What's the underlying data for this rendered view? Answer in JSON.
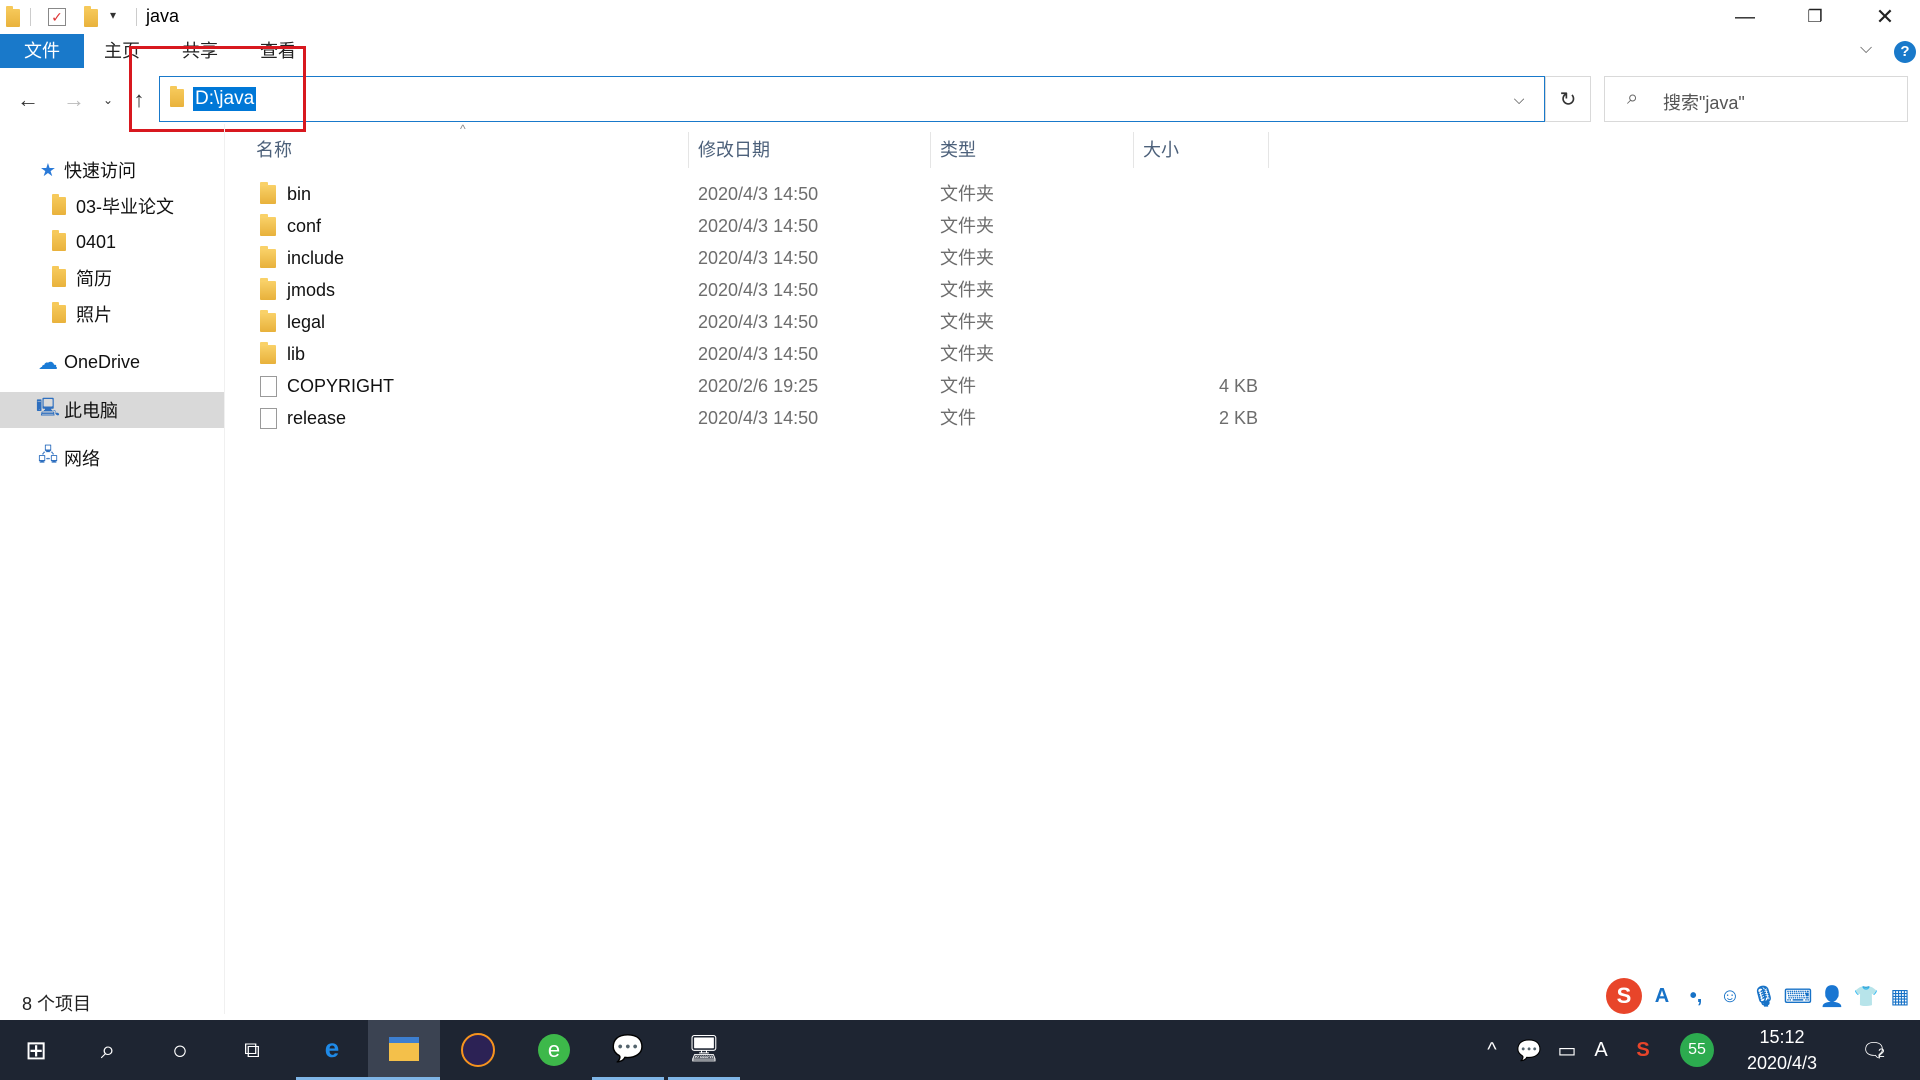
{
  "window": {
    "title": "java",
    "minimize_icon": "minimize-icon",
    "maximize_icon": "restore-icon",
    "close_icon": "close-icon"
  },
  "ribbon": {
    "tabs": [
      {
        "label": "文件",
        "active": true
      },
      {
        "label": "主页"
      },
      {
        "label": "共享"
      },
      {
        "label": "查看"
      }
    ]
  },
  "address": {
    "path": "D:\\java",
    "search_placeholder": "搜索\"java\""
  },
  "sidebar": {
    "items": [
      {
        "label": "快速访问",
        "icon": "star-icon"
      },
      {
        "label": "03-毕业论文",
        "icon": "folder-icon"
      },
      {
        "label": "0401",
        "icon": "folder-icon"
      },
      {
        "label": "简历",
        "icon": "folder-icon"
      },
      {
        "label": "照片",
        "icon": "folder-icon"
      },
      {
        "label": "OneDrive",
        "icon": "cloud-icon"
      },
      {
        "label": "此电脑",
        "icon": "computer-icon",
        "selected": true
      },
      {
        "label": "网络",
        "icon": "network-icon"
      }
    ]
  },
  "columns": {
    "name": "名称",
    "date": "修改日期",
    "type": "类型",
    "size": "大小"
  },
  "files": [
    {
      "name": "bin",
      "date": "2020/4/3 14:50",
      "type": "文件夹",
      "size": "",
      "kind": "folder"
    },
    {
      "name": "conf",
      "date": "2020/4/3 14:50",
      "type": "文件夹",
      "size": "",
      "kind": "folder"
    },
    {
      "name": "include",
      "date": "2020/4/3 14:50",
      "type": "文件夹",
      "size": "",
      "kind": "folder"
    },
    {
      "name": "jmods",
      "date": "2020/4/3 14:50",
      "type": "文件夹",
      "size": "",
      "kind": "folder"
    },
    {
      "name": "legal",
      "date": "2020/4/3 14:50",
      "type": "文件夹",
      "size": "",
      "kind": "folder"
    },
    {
      "name": "lib",
      "date": "2020/4/3 14:50",
      "type": "文件夹",
      "size": "",
      "kind": "folder"
    },
    {
      "name": "COPYRIGHT",
      "date": "2020/2/6 19:25",
      "type": "文件",
      "size": "4 KB",
      "kind": "file"
    },
    {
      "name": "release",
      "date": "2020/4/3 14:50",
      "type": "文件",
      "size": "2 KB",
      "kind": "file"
    }
  ],
  "status": {
    "item_count": "8 个项目"
  },
  "tray": {
    "time": "15:12",
    "date": "2020/4/3",
    "badge": "55",
    "notifications": "2"
  },
  "colors": {
    "accent": "#1979ca",
    "selection": "#0078d7",
    "highlight_box": "#d8181f",
    "taskbar": "#1e2532"
  }
}
